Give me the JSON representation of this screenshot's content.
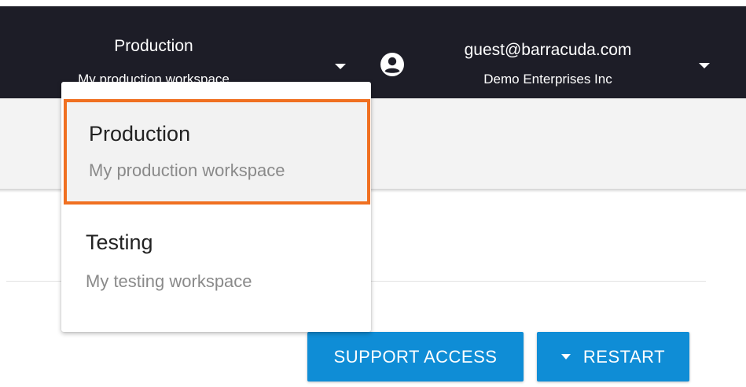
{
  "workspace_switcher": {
    "current_name": "Production",
    "current_description": "My production workspace",
    "options": [
      {
        "name": "Production",
        "description": "My production workspace",
        "selected": true
      },
      {
        "name": "Testing",
        "description": "My testing workspace",
        "selected": false
      }
    ]
  },
  "account": {
    "email": "guest@barracuda.com",
    "organization": "Demo Enterprises Inc",
    "icon": "account-circle-icon"
  },
  "actions": {
    "support_access_label": "SUPPORT ACCESS",
    "restart_label": "RESTART"
  },
  "colors": {
    "topbar": "#1d1d27",
    "highlight": "#f07021",
    "button": "#0f8dd6"
  }
}
